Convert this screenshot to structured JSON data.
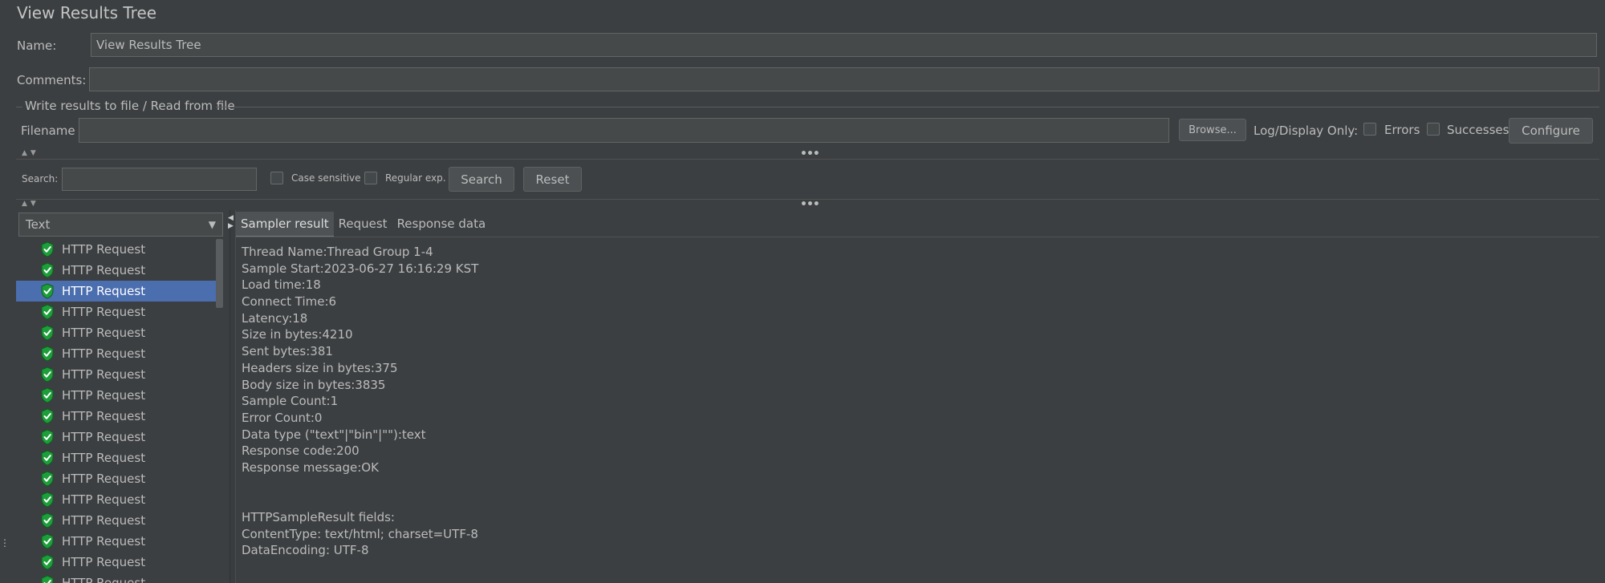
{
  "panel": {
    "title": "View Results Tree",
    "name_label": "Name:",
    "name_value": "View Results Tree",
    "comments_label": "Comments:",
    "comments_value": ""
  },
  "file_section": {
    "legend": "Write results to file / Read from file",
    "filename_label": "Filename",
    "filename_value": "",
    "browse_label": "Browse...",
    "log_display_label": "Log/Display Only:",
    "errors_label": "Errors",
    "errors_checked": false,
    "successes_label": "Successes",
    "successes_checked": false,
    "configure_label": "Configure"
  },
  "search_bar": {
    "search_label": "Search:",
    "search_value": "",
    "case_sensitive_label": "Case sensitive",
    "regular_exp_label": "Regular exp.",
    "search_button": "Search",
    "reset_button": "Reset"
  },
  "renderer": {
    "selected": "Text"
  },
  "tree": {
    "items": [
      "HTTP Request",
      "HTTP Request",
      "HTTP Request",
      "HTTP Request",
      "HTTP Request",
      "HTTP Request",
      "HTTP Request",
      "HTTP Request",
      "HTTP Request",
      "HTTP Request",
      "HTTP Request",
      "HTTP Request",
      "HTTP Request",
      "HTTP Request",
      "HTTP Request",
      "HTTP Request",
      "HTTP Request"
    ],
    "selected_index": 2,
    "icon": "green-check-shield-icon",
    "success_color": "#1e9e3a"
  },
  "tabs": [
    "Sampler result",
    "Request",
    "Response data"
  ],
  "active_tab": 0,
  "sampler_result": {
    "lines": [
      "Thread Name:Thread Group 1-4",
      "Sample Start:2023-06-27 16:16:29 KST",
      "Load time:18",
      "Connect Time:6",
      "Latency:18",
      "Size in bytes:4210",
      "Sent bytes:381",
      "Headers size in bytes:375",
      "Body size in bytes:3835",
      "Sample Count:1",
      "Error Count:0",
      "Data type (\"text\"|\"bin\"|\"\"):text",
      "Response code:200",
      "Response message:OK",
      "",
      "",
      "HTTPSampleResult fields:",
      "ContentType: text/html; charset=UTF-8",
      "DataEncoding: UTF-8"
    ]
  },
  "colors": {
    "background": "#3c3f41",
    "selection": "#4b6eaf"
  }
}
